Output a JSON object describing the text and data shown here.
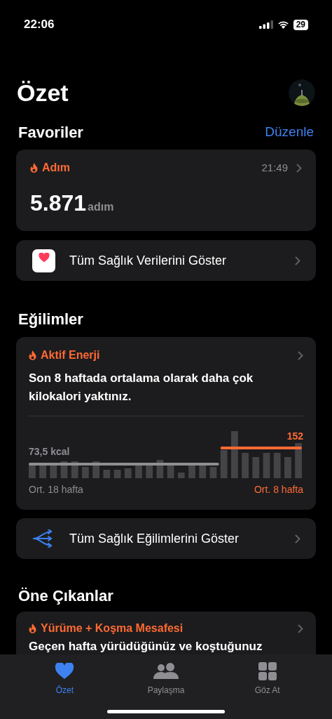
{
  "status_bar": {
    "time": "22:06",
    "battery": "29"
  },
  "header": {
    "title": "Özet"
  },
  "favorites": {
    "title": "Favoriler",
    "edit": "Düzenle",
    "metric": {
      "name": "Adım",
      "time": "21:49",
      "value": "5.871",
      "unit": "adım"
    },
    "show_all": "Tüm Sağlık Verilerini Göster"
  },
  "trends": {
    "title": "Eğilimler",
    "card": {
      "name": "Aktif Enerji",
      "message": "Son 8 haftada ortalama olarak daha çok kilokalori yaktınız.",
      "past_average": "73,5 kcal",
      "recent_average": "152",
      "past_label": "Ort. 18 hafta",
      "recent_label": "Ort. 8 hafta"
    },
    "show_all": "Tüm Sağlık Eğilimlerini Göster"
  },
  "highlights": {
    "title": "Öne Çıkanlar",
    "card": {
      "name": "Yürüme + Koşma Mesafesi",
      "message": "Geçen hafta yürüdüğünüz ve koştuğunuz"
    }
  },
  "tab_bar": [
    {
      "label": "Özet",
      "selected": true,
      "kind": "heart"
    },
    {
      "label": "Paylaşma",
      "selected": false,
      "kind": "people"
    },
    {
      "label": "Göz At",
      "selected": false,
      "kind": "grid"
    }
  ]
}
